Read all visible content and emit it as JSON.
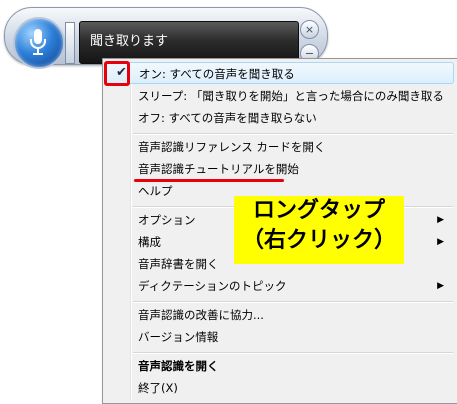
{
  "speech_bar": {
    "status": "聞き取ります"
  },
  "menu": {
    "items": [
      {
        "label": "オン: すべての音声を聞き取る",
        "checked": true
      },
      {
        "label": "スリープ: 「聞き取りを開始」と言った場合にのみ聞き取る"
      },
      {
        "label": "オフ: すべての音声を聞き取らない"
      },
      {
        "label": "音声認識リファレンス カードを開く"
      },
      {
        "label": "音声認識チュートリアルを開始"
      },
      {
        "label": "ヘルプ"
      },
      {
        "label": "オプション",
        "submenu": true
      },
      {
        "label": "構成",
        "submenu": true
      },
      {
        "label": "音声辞書を開く"
      },
      {
        "label": "ディクテーションのトピック",
        "submenu": true
      },
      {
        "label": "音声認識の改善に協力..."
      },
      {
        "label": "バージョン情報"
      },
      {
        "label": "音声認識を開く",
        "bold": true
      },
      {
        "label": "終了(X)"
      }
    ]
  },
  "annotation": {
    "callout_line1": "ロングタップ",
    "callout_line2": "（右クリック）",
    "accent_color": "#e8000b",
    "callout_color": "#ffff00"
  }
}
